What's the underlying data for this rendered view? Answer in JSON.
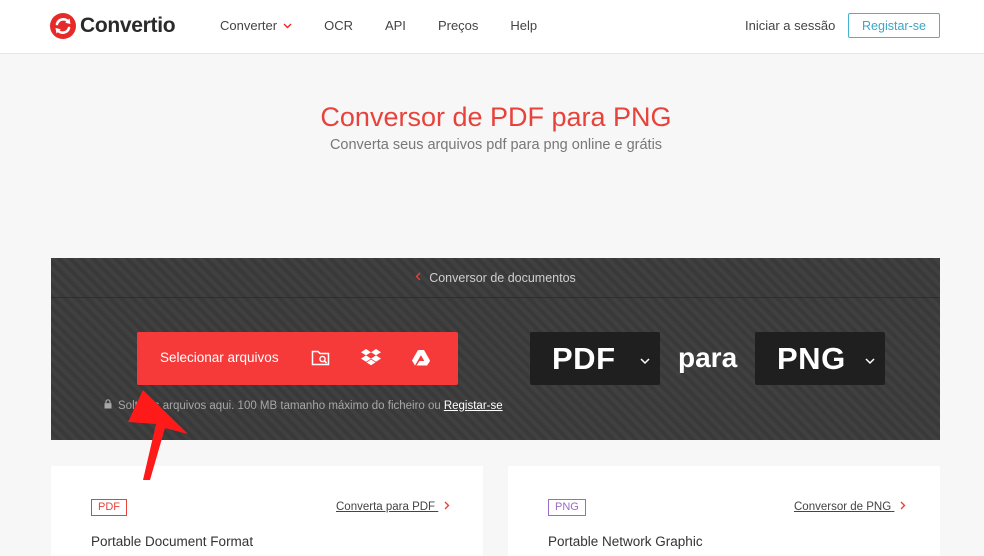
{
  "header": {
    "logo_text": "Convertio",
    "nav": [
      {
        "label": "Converter",
        "has_dropdown": true
      },
      {
        "label": "OCR",
        "has_dropdown": false
      },
      {
        "label": "API",
        "has_dropdown": false
      },
      {
        "label": "Preços",
        "has_dropdown": false
      },
      {
        "label": "Help",
        "has_dropdown": false
      }
    ],
    "signin_label": "Iniciar a sessão",
    "register_label": "Registar-se"
  },
  "hero": {
    "title": "Conversor de PDF para PNG",
    "subtitle": "Converta seus arquivos pdf para png online e grátis"
  },
  "converter": {
    "breadcrumb": "Conversor de documentos",
    "select_files_label": "Selecionar arquivos",
    "source_icons": [
      "folder-search-icon",
      "dropbox-icon",
      "google-drive-icon"
    ],
    "drop_note": "Solte os arquivos aqui. 100 MB tamanho máximo do ficheiro ou",
    "drop_note_link": "Registar-se",
    "from_format": "PDF",
    "joiner": "para",
    "to_format": "PNG"
  },
  "cards": [
    {
      "badge": "PDF",
      "badge_color": "#e8423b",
      "link": "Converta para PDF",
      "title": "Portable Document Format"
    },
    {
      "badge": "PNG",
      "badge_color": "#9b6bc9",
      "link": "Conversor de PNG",
      "title": "Portable Network Graphic"
    }
  ],
  "colors": {
    "accent_red": "#f63a3a",
    "title_red": "#e8423b",
    "panel_bg": "#3b3b3b",
    "register_blue": "#3aa6c6"
  }
}
